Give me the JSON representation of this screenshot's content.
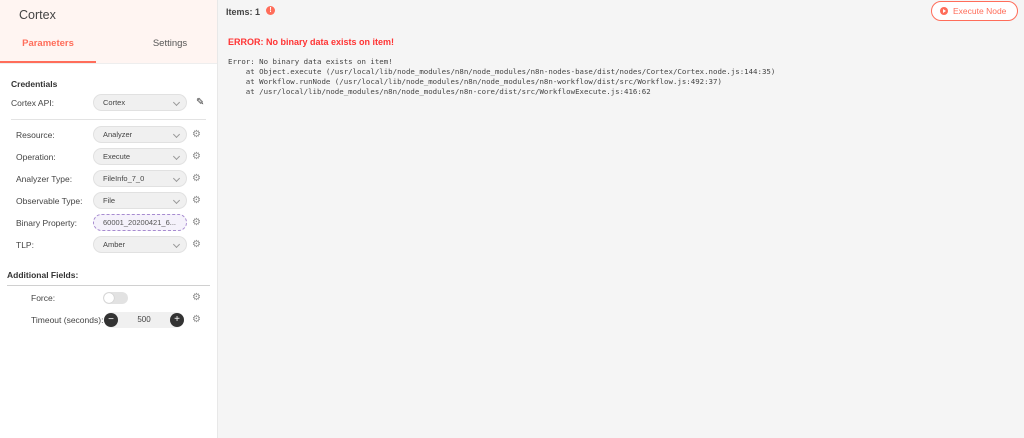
{
  "node": {
    "title": "Cortex"
  },
  "tabs": {
    "parameters": "Parameters",
    "settings": "Settings"
  },
  "credentials": {
    "section_title": "Credentials",
    "api_label": "Cortex API:",
    "api_value": "Cortex"
  },
  "params": [
    {
      "label": "Resource:",
      "value": "Analyzer"
    },
    {
      "label": "Operation:",
      "value": "Execute"
    },
    {
      "label": "Analyzer Type:",
      "value": "FileInfo_7_0"
    },
    {
      "label": "Observable Type:",
      "value": "File"
    },
    {
      "label": "Binary Property:",
      "value": "60001_20200421_6..."
    },
    {
      "label": "TLP:",
      "value": "Amber"
    }
  ],
  "additional": {
    "section_title": "Additional Fields:",
    "force_label": "Force:",
    "force_on": false,
    "timeout_label": "Timeout (seconds):",
    "timeout_value": "500"
  },
  "output": {
    "items_label": "Items: 1",
    "execute_label": "Execute Node",
    "error_title": "ERROR: No binary data exists on item!",
    "error_lines": [
      "Error: No binary data exists on item!",
      "    at Object.execute (/usr/local/lib/node_modules/n8n/node_modules/n8n-nodes-base/dist/nodes/Cortex/Cortex.node.js:144:35)",
      "    at Workflow.runNode (/usr/local/lib/node_modules/n8n/node_modules/n8n-workflow/dist/src/Workflow.js:492:37)",
      "    at /usr/local/lib/node_modules/n8n/node_modules/n8n-core/dist/src/WorkflowExecute.js:416:62"
    ]
  },
  "colors": {
    "accent": "#ff6d5a",
    "error": "#ff3333"
  },
  "icons": {
    "options": "cogs-icon",
    "edit": "pencil-icon",
    "warning": "warning-icon",
    "execute": "play-circle-icon"
  }
}
